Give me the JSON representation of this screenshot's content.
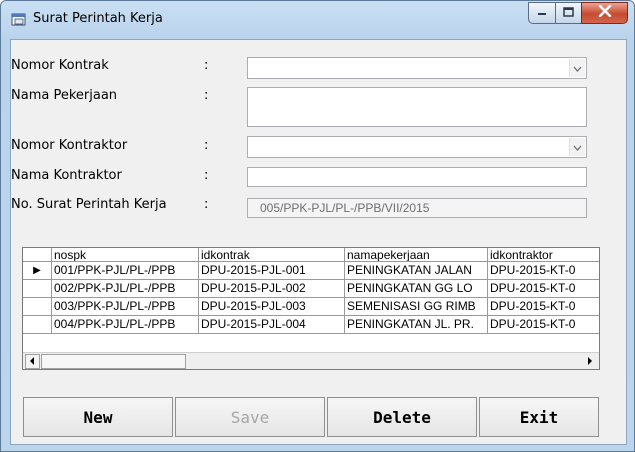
{
  "window": {
    "title": "Surat Perintah Kerja"
  },
  "form": {
    "nomor_kontrak_label": "Nomor Kontrak",
    "nama_pekerjaan_label": "Nama Pekerjaan",
    "nomor_kontraktor_label": "Nomor Kontraktor",
    "nama_kontraktor_label": "Nama Kontraktor",
    "no_spk_label": "No. Surat Perintah Kerja",
    "colon": ":",
    "nomor_kontrak_value": "",
    "nama_pekerjaan_value": "",
    "nomor_kontraktor_value": "",
    "nama_kontraktor_value": "",
    "no_spk_value": "005/PPK-PJL/PL-/PPB/VII/2015"
  },
  "grid": {
    "columns": [
      "nospk",
      "idkontrak",
      "namapekerjaan",
      "idkontraktor"
    ],
    "rows": [
      [
        "001/PPK-PJL/PL-/PPB",
        "DPU-2015-PJL-001",
        "PENINGKATAN JALAN",
        "DPU-2015-KT-0"
      ],
      [
        "002/PPK-PJL/PL-/PPB",
        "DPU-2015-PJL-002",
        "PENINGKATAN GG LO",
        "DPU-2015-KT-0"
      ],
      [
        "003/PPK-PJL/PL-/PPB",
        "DPU-2015-PJL-003",
        "SEMENISASI GG RIMB",
        "DPU-2015-KT-0"
      ],
      [
        "004/PPK-PJL/PL-/PPB",
        "DPU-2015-PJL-004",
        "PENINGKATAN JL. PR.",
        "DPU-2015-KT-0"
      ]
    ],
    "current_row_marker": "▶"
  },
  "buttons": {
    "new": "New",
    "save": "Save",
    "delete": "Delete",
    "exit": "Exit"
  },
  "icons": {
    "app": "window-app-icon",
    "minimize": "minimize-icon",
    "maximize": "maximize-icon",
    "close": "close-icon",
    "combo": "chevron-down-icon",
    "scroll_left": "arrow-left-icon",
    "scroll_right": "arrow-right-icon"
  }
}
